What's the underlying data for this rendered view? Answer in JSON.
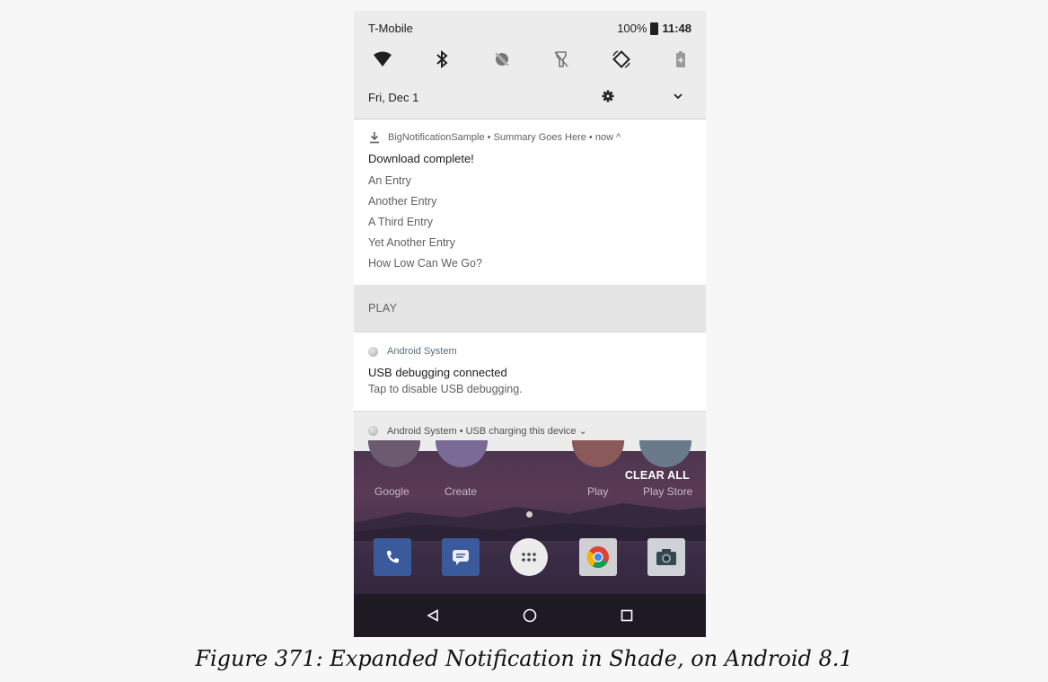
{
  "status_bar": {
    "carrier": "T-Mobile",
    "battery": "100%",
    "time": "11:48"
  },
  "quick_settings": {
    "tiles": [
      "wifi-icon",
      "bluetooth-icon",
      "do-not-disturb-off-icon",
      "flashlight-off-icon",
      "auto-rotate-icon",
      "battery-saver-icon"
    ],
    "date": "Fri, Dec 1"
  },
  "notification_big": {
    "header": "BigNotificationSample • Summary Goes Here • now ^",
    "title": "Download complete!",
    "entries": [
      "An Entry",
      "Another Entry",
      "A Third Entry",
      "Yet Another Entry",
      "How Low Can We Go?"
    ]
  },
  "section": {
    "label": "PLAY"
  },
  "notification_usb": {
    "header": "Android System",
    "title": "USB debugging connected",
    "text": "Tap to disable USB debugging."
  },
  "notification_charging": {
    "header": "Android System • USB charging this device ⌄"
  },
  "home": {
    "apps": [
      "Google",
      "Create",
      "Play",
      "Play Store"
    ],
    "clear_all": "CLEAR ALL",
    "dock": [
      "phone-icon",
      "messages-icon",
      "app-drawer-icon",
      "chrome-icon",
      "camera-icon"
    ]
  },
  "navigation": [
    "back-icon",
    "home-icon",
    "recents-icon"
  ],
  "caption": "Figure 371: Expanded Notification in Shade, on Android 8.1",
  "colors": {
    "shade_bg": "#ececec",
    "notification_bg": "#ffffff",
    "section_bg": "#e5e5e5",
    "wallpaper": "#4e3650"
  }
}
